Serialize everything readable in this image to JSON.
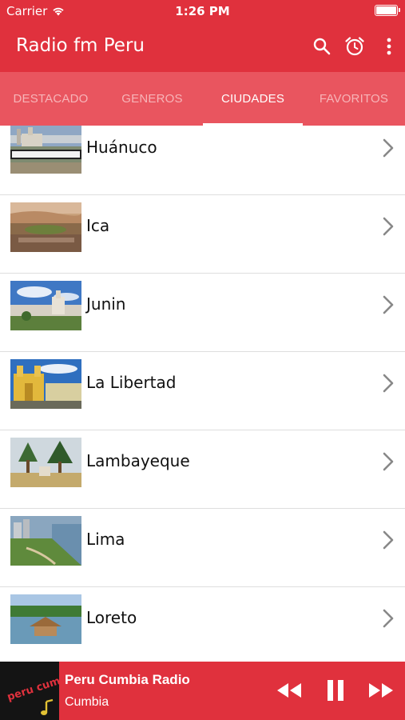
{
  "status_bar": {
    "carrier": "Carrier",
    "time": "1:26 PM"
  },
  "app_bar": {
    "title": "Radio fm Peru",
    "icons": [
      "search-icon",
      "alarm-icon",
      "more-vert-icon"
    ]
  },
  "tabs": [
    {
      "label": "DESTACADO",
      "active": false
    },
    {
      "label": "GENEROS",
      "active": false
    },
    {
      "label": "CIUDADES",
      "active": true
    },
    {
      "label": "FAVORITOS",
      "active": false
    }
  ],
  "cities": [
    {
      "name": "Huánuco"
    },
    {
      "name": "Ica"
    },
    {
      "name": "Junin"
    },
    {
      "name": "La Libertad"
    },
    {
      "name": "Lambayeque"
    },
    {
      "name": "Lima"
    },
    {
      "name": "Loreto"
    }
  ],
  "player": {
    "station": "Peru Cumbia Radio",
    "genre": "Cumbia",
    "logo_text": "peru cumbia",
    "controls": [
      "rewind-icon",
      "pause-icon",
      "fast-forward-icon"
    ]
  },
  "colors": {
    "primary": "#e0313d",
    "tab_bar": "#e9555f",
    "tab_inactive": "#f7b4b8"
  }
}
